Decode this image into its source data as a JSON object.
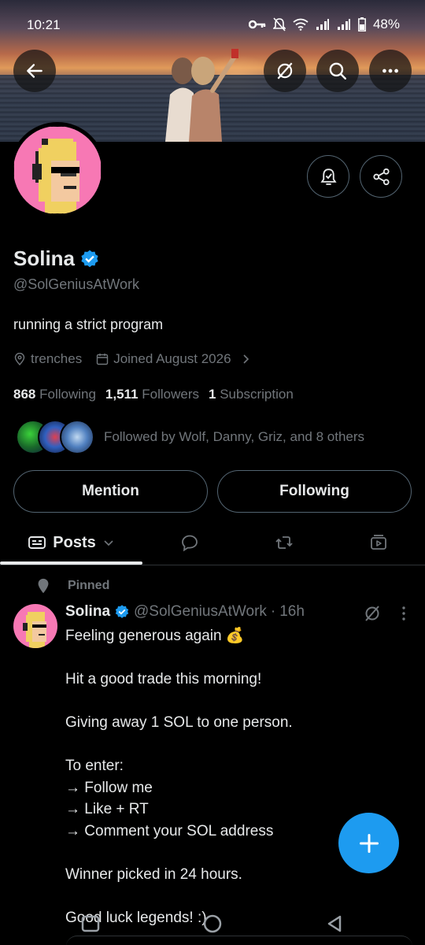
{
  "status_bar": {
    "time": "10:21",
    "battery": "48%"
  },
  "profile": {
    "name": "Solina",
    "handle": "@SolGeniusAtWork",
    "bio": "running a strict program",
    "location": "trenches",
    "joined": "Joined August 2026",
    "following_count": "868",
    "following_label": "Following",
    "followers_count": "1,511",
    "followers_label": "Followers",
    "subscription_count": "1",
    "subscription_label": "Subscription",
    "followed_by": "Followed by Wolf, Danny, Griz, and 8 others"
  },
  "actions": {
    "mention": "Mention",
    "following": "Following"
  },
  "tabs": {
    "posts": "Posts"
  },
  "tweet": {
    "pinned_label": "Pinned",
    "name": "Solina",
    "handle": "@SolGeniusAtWork",
    "dot": "·",
    "time": "16h",
    "body": "Feeling generous again 💰\n\nHit a good trade this morning!\n\nGiving away 1 SOL to one person.\n\nTo enter:\n→ Follow me\n→ Like + RT\n→ Comment your SOL address\n\nWinner picked in 24 hours.\n\nGood luck legends! :)"
  },
  "colors": {
    "accent": "#1d9bf0",
    "background": "#000000",
    "secondary_text": "#71767b",
    "avatar_bg": "#f778b4"
  }
}
